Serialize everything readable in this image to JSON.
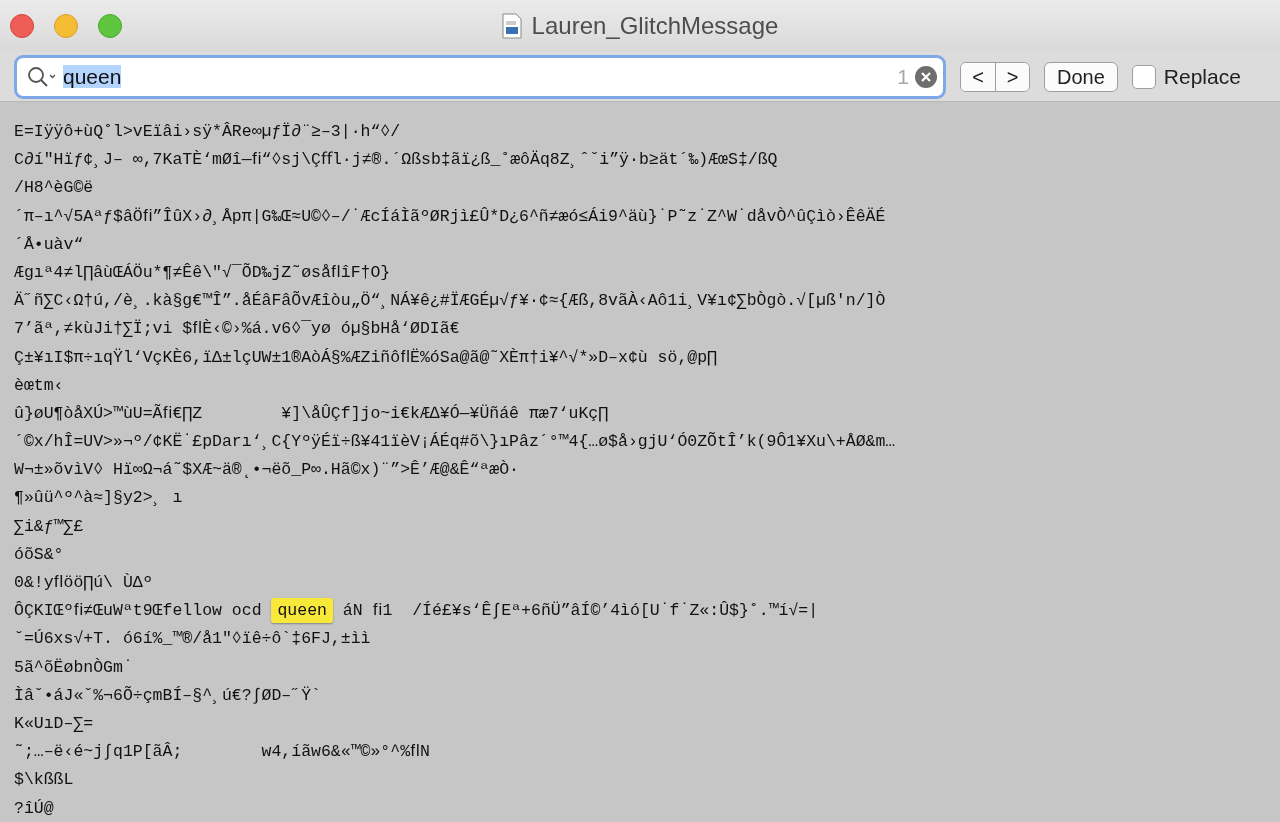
{
  "window": {
    "title": "Lauren_GlitchMessage"
  },
  "find_bar": {
    "query": "queen",
    "query_selected": true,
    "match_count": "1",
    "nav_buttons": [
      "<",
      ">"
    ],
    "done_label": "Done",
    "replace": {
      "label": "Replace",
      "checked": false
    }
  },
  "document": {
    "lines": [
      {
        "kind": "plain",
        "text": "E=Iÿÿô+ùQ˚l>vEïâi›sÿ*ÂRe∞µƒÏ∂¨≥–3|·h“◊/"
      },
      {
        "kind": "plain",
        "text": "C∂í\"Hïƒ¢¸J– ∞,7KaTÈ‘mØî—ﬁ“◊sj\\Çﬀl·j≠®.´Ωßsb‡ãï¿ß_˚æôÄq8Z¸ˆˇi”ÿ·b≥ät´‰)ÆœS‡/ßQ"
      },
      {
        "kind": "plain",
        "text": "/H8^èG©ë"
      },
      {
        "kind": "plain",
        "text": "´π–ı^√5Aªƒ$âÖﬁ”ÎûX›∂¸Åpπ|G‰Œ≈U©◊–/˙ÆcÍáÌãºØRjì£Û*D¿6^ñ≠æó≤Ái9^äù}˙P˜z˙Z^W˙dåvÒ^ûÇìò›ÊêÄÉ"
      },
      {
        "kind": "plain",
        "text": "´Å•uàv“"
      },
      {
        "kind": "plain",
        "text": "Ægıª4≠l∏âùŒÁÖu*¶≠Êê\\\"√¯ÕD‰jZ˜øsåﬂîF†O}"
      },
      {
        "kind": "plain",
        "text": "Ä˝ñ∑C‹Ω†ú,/è¸.kà§g€™Î”.åÉâFâÕvÆîòu„Ö“¸NÁ¥ê¿#ÏÆGÉµ√ƒ¥·¢≈{Æß,8vãÀ‹Aô1i¸V¥ı¢∑bÒgò.√[µß'n/]Ò"
      },
      {
        "kind": "plain",
        "text": "7’ãª,≠kùJi†∑Ï;vi $ﬂÈ‹©›%á.v6◊¯yø óµ§bHå‘ØDIã€"
      },
      {
        "kind": "plain",
        "text": "Ç±¥ıI$π÷ıqŸl‘VçKÈ6,ïΔ±lçUW±1®AòÁ§%ÆZiñôﬂË%óSa@ã@˜XÈπ†i¥^√*»D–x¢ù sö,@p∏"
      },
      {
        "kind": "plain",
        "text": "èœtm‹"
      },
      {
        "kind": "plain",
        "text": "û}øU¶òåXÚ>™ùU=Ãﬁ€∏Z        ¥]\\åÛÇf]jo~i€kÆ∆¥Ó—¥Üñáê πæ7‘uKç∏"
      },
      {
        "kind": "plain",
        "text": "´©x/hÎ=UV>»¬º/¢KË˙£pDarı‘¸C{YºÿÉï÷ß¥41ïèV¡ÁÉq#õ\\}ıPâz´°™4{…ø$å›gjU‘Ó0ZÕtÎ’k(9Ô1¥Xu\\+ÅØ&m…"
      },
      {
        "kind": "plain",
        "text": "W¬±»õvìV◊ Hï∞Ω¬á˜$XÆ~ä®˛•¬ëõ_P∞.Hã©x)¨”>Ê’Æ@&Ê“ªæÒ·"
      },
      {
        "kind": "plain",
        "text": "¶»ûü^º^à≈]§y2>¸ ı"
      },
      {
        "kind": "plain",
        "text": "∑i&ƒ™∑£"
      },
      {
        "kind": "plain",
        "text": "óõS&°"
      },
      {
        "kind": "plain",
        "text": "0&!yﬂöö∏ú\\ ÙΔº"
      },
      {
        "kind": "match",
        "before": "ÔÇKIŒºﬁ≠ŒuWªt9Œfellow ocd ",
        "match": "queen",
        "after": " áN ﬁ1  /Íé£¥s‘Ê∫Eª+6ñÜ”âÍ©’4ìó[U˙f˙Z«:Û$}˚.™í√=|"
      },
      {
        "kind": "plain",
        "text": "˘=Ú6xs√+T. ó6í%_™®/å1\"◊ïê÷ô`‡6FJ,±ìì"
      },
      {
        "kind": "plain",
        "text": "5ã^õËøbnÒGm˙"
      },
      {
        "kind": "plain",
        "text": "Ìâˇ•áJ«ˇ%¬6Õ÷çmBÍ–§^¸ú€?∫ØD–˝Ÿ`"
      },
      {
        "kind": "plain",
        "text": "K«UıD–∑="
      },
      {
        "kind": "plain",
        "text": "˜;…–ë‹é~j∫q1P[ãÂ;        w4,íãw6&«™©»°^%ﬂN"
      },
      {
        "kind": "plain",
        "text": "$\\kßßL"
      },
      {
        "kind": "plain",
        "text": "?îÚ@"
      }
    ]
  }
}
